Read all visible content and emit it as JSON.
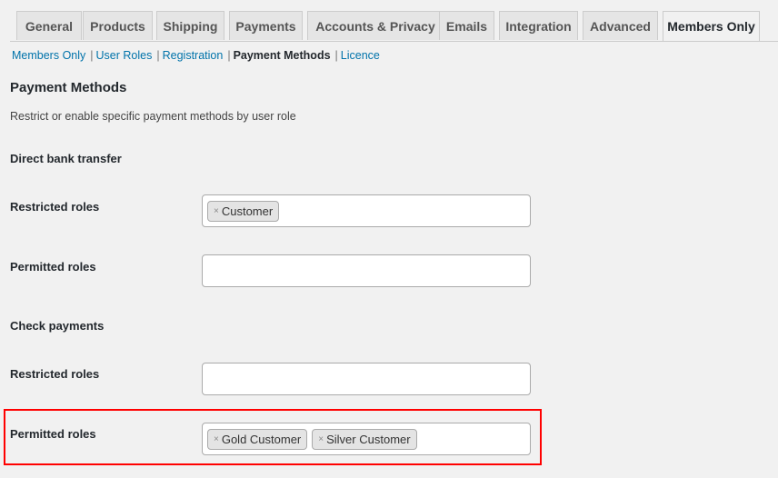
{
  "tabs": [
    {
      "label": "General",
      "active": false
    },
    {
      "label": "Products",
      "active": false
    },
    {
      "label": "Shipping",
      "active": false
    },
    {
      "label": "Payments",
      "active": false
    },
    {
      "label": "Accounts & Privacy",
      "active": false
    },
    {
      "label": "Emails",
      "active": false
    },
    {
      "label": "Integration",
      "active": false
    },
    {
      "label": "Advanced",
      "active": false
    },
    {
      "label": "Members Only",
      "active": true
    }
  ],
  "subnav": {
    "items": [
      "Members Only",
      "User Roles",
      "Registration",
      "Payment Methods",
      "Licence"
    ],
    "separator": "|",
    "current": "Payment Methods"
  },
  "page": {
    "title": "Payment Methods",
    "description": "Restrict or enable specific payment methods by user role"
  },
  "sections": [
    {
      "title": "Direct bank transfer",
      "restricted_label": "Restricted roles",
      "restricted_roles": [
        "Customer"
      ],
      "permitted_label": "Permitted roles",
      "permitted_roles": []
    },
    {
      "title": "Check payments",
      "restricted_label": "Restricted roles",
      "restricted_roles": [],
      "permitted_label": "Permitted roles",
      "permitted_roles": [
        "Gold Customer",
        "Silver Customer"
      ]
    }
  ],
  "icons": {
    "remove": "×"
  },
  "colors": {
    "link": "#0073aa",
    "highlight": "#ff0000"
  }
}
